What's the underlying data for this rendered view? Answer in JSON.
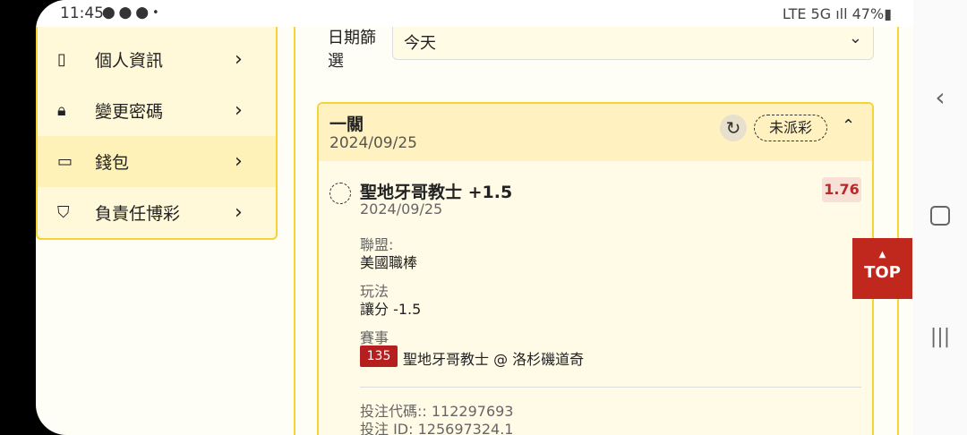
{
  "status_bar": {
    "time": "11:45",
    "left_icons": "⬤ ⬤ ⬤ •",
    "right_icons": "LTE 5G ıll 47%▮"
  },
  "sidebar": {
    "items": [
      {
        "label": "個人資訊",
        "icon": "notebook-icon"
      },
      {
        "label": "變更密碼",
        "icon": "lock-icon"
      },
      {
        "label": "錢包",
        "icon": "wallet-icon"
      },
      {
        "label": "負責任博彩",
        "icon": "shield-star-icon"
      }
    ]
  },
  "filter": {
    "label": "日期篩選",
    "value": "今天"
  },
  "card": {
    "title": "一關",
    "date": "2024/09/25",
    "status_badge": "未派彩",
    "bet": {
      "name": "聖地牙哥教士 +1.5",
      "date": "2024/09/25",
      "odds": "1.76",
      "league_label": "聯盟:",
      "league_value": "美國職棒",
      "play_label": "玩法",
      "play_value": "讓分 -1.5",
      "event_label": "賽事",
      "event_number": "135",
      "event_name": "聖地牙哥教士 @ 洛杉磯道奇"
    },
    "bet_code": "投注代碼:: 112297693",
    "bet_id": "投注 ID: 125697324.1"
  },
  "top_button": {
    "label": "TOP"
  },
  "colors": {
    "accent": "#f5d435",
    "brand_red": "#c0281d",
    "odds_red": "#b52b2b"
  }
}
